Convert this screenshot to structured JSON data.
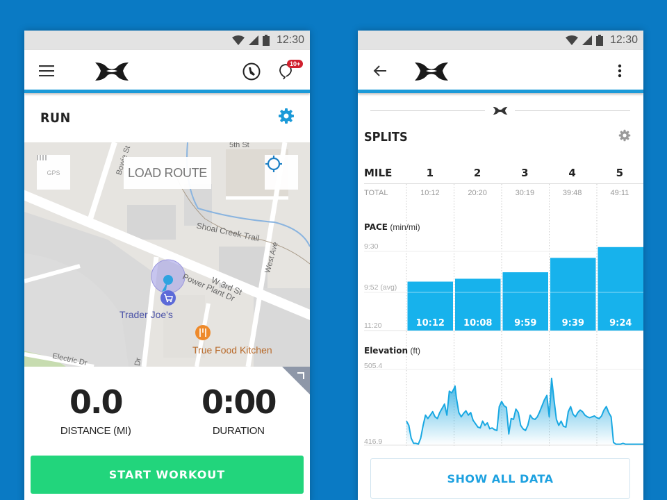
{
  "colors": {
    "background": "#0a7ac4",
    "accent_blue": "#1c9ad8",
    "bar_blue": "#17b2ec",
    "start_green": "#22d57c",
    "badge_red": "#d0202e"
  },
  "left_screen": {
    "status_bar": {
      "time": "12:30",
      "icons": [
        "wifi-icon",
        "cell-signal-icon",
        "battery-icon"
      ]
    },
    "app_bar": {
      "menu_icon": "hamburger-menu-icon",
      "logo": "under-armour-logo",
      "shoe_icon": "shoe-icon",
      "notification_icon": "notification-bell-icon",
      "notification_badge": "10+"
    },
    "activity_title": "RUN",
    "settings_icon": "gear-icon",
    "map": {
      "gps_label": "GPS",
      "load_route_label": "LOAD ROUTE",
      "locate_icon": "crosshair-icon",
      "street_labels": [
        "Bowie St",
        "5th St",
        "Shoal Creek Trail",
        "West Ave",
        "W 3rd St",
        "Power Plant Dr",
        "Electric Dr",
        "Dr"
      ],
      "places": [
        {
          "name": "Trader Joe's",
          "icon": "shopping-cart-icon"
        },
        {
          "name": "True Food Kitchen",
          "icon": "restaurant-icon"
        }
      ]
    },
    "stats": [
      {
        "value": "0.0",
        "label": "DISTANCE (MI)"
      },
      {
        "value": "0:00",
        "label": "DURATION"
      }
    ],
    "start_button": "START WORKOUT"
  },
  "right_screen": {
    "status_bar": {
      "time": "12:30"
    },
    "app_bar": {
      "back_icon": "back-arrow-icon",
      "logo": "under-armour-logo",
      "more_icon": "more-vert-icon"
    },
    "section_title": "SPLITS",
    "settings_icon": "gear-icon",
    "table": {
      "mile_label": "MILE",
      "total_label": "TOTAL",
      "miles": [
        "1",
        "2",
        "3",
        "4",
        "5"
      ],
      "totals": [
        "10:12",
        "20:20",
        "30:19",
        "39:48",
        "49:11"
      ]
    },
    "pace": {
      "title_bold": "PACE",
      "title_unit": "(min/mi)",
      "axis_labels": {
        "top": "9:30",
        "avg": "9:52 (avg)",
        "bottom": "11:20"
      }
    },
    "elevation": {
      "title_bold": "Elevation",
      "title_unit": "(ft)",
      "axis_labels": {
        "top": "505.4",
        "bottom": "416.9"
      }
    },
    "show_all_button": "SHOW ALL DATA"
  },
  "chart_data": [
    {
      "type": "bar",
      "title": "PACE (min/mi)",
      "categories": [
        "1",
        "2",
        "3",
        "4",
        "5"
      ],
      "values_label": [
        "10:12",
        "10:08",
        "9:59",
        "9:39",
        "9:24"
      ],
      "values_seconds": [
        612,
        608,
        599,
        579,
        564
      ],
      "y_ticks": [
        "9:30",
        "9:52 (avg)",
        "11:20"
      ],
      "note": "inverted axis: faster pace = taller bar",
      "ylim_seconds": [
        680,
        570
      ]
    },
    {
      "type": "area",
      "title": "Elevation (ft)",
      "ylim": [
        416.9,
        505.4
      ],
      "xlabel": "mile",
      "x": [
        0,
        0.05,
        0.1,
        0.15,
        0.2,
        0.25,
        0.3,
        0.35,
        0.4,
        0.45,
        0.5,
        0.55,
        0.6,
        0.65,
        0.7,
        0.75,
        0.8,
        0.85,
        0.9,
        0.95,
        1.0,
        1.02,
        1.05,
        1.1,
        1.15,
        1.2,
        1.25,
        1.3,
        1.35,
        1.4,
        1.45,
        1.5,
        1.55,
        1.6,
        1.65,
        1.7,
        1.75,
        1.8,
        1.85,
        1.9,
        1.95,
        2.0,
        2.05,
        2.1,
        2.15,
        2.2,
        2.25,
        2.3,
        2.35,
        2.4,
        2.45,
        2.5,
        2.55,
        2.6,
        2.65,
        2.7,
        2.75,
        2.8,
        2.85,
        2.9,
        2.95,
        3.0,
        3.05,
        3.1,
        3.15,
        3.2,
        3.25,
        3.3,
        3.35,
        3.4,
        3.45,
        3.5,
        3.55,
        3.6,
        3.65,
        3.7,
        3.75,
        3.8,
        3.85,
        3.9,
        3.95,
        4.0,
        4.05,
        4.1,
        4.15,
        4.2,
        4.25,
        4.3,
        4.35,
        4.4,
        4.45,
        4.5,
        4.55,
        4.6,
        4.65,
        4.7,
        4.75,
        4.8,
        4.85,
        4.9,
        4.95,
        5.0
      ],
      "y": [
        445,
        440,
        425,
        419,
        419,
        418,
        425,
        440,
        452,
        448,
        452,
        456,
        450,
        448,
        455,
        460,
        465,
        452,
        480,
        478,
        483,
        486,
        472,
        455,
        450,
        454,
        457,
        452,
        455,
        446,
        442,
        438,
        437,
        445,
        440,
        443,
        436,
        437,
        435,
        434,
        462,
        468,
        463,
        461,
        430,
        448,
        447,
        459,
        455,
        440,
        436,
        434,
        440,
        452,
        448,
        447,
        450,
        456,
        463,
        470,
        475,
        450,
        495,
        470,
        447,
        440,
        445,
        439,
        438,
        456,
        462,
        453,
        450,
        455,
        458,
        456,
        452,
        450,
        449,
        450,
        451,
        449,
        448,
        451,
        458,
        462,
        455,
        450,
        420,
        418,
        418,
        418,
        419,
        418,
        418,
        418,
        418,
        418,
        418,
        418,
        418,
        418
      ],
      "vertical_gridlines_at_miles": [
        1,
        2,
        3,
        4
      ]
    }
  ]
}
